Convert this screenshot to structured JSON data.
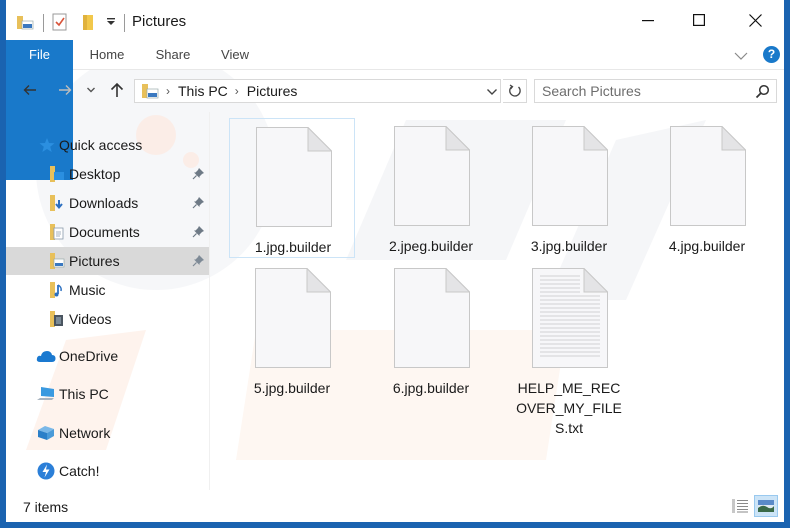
{
  "window": {
    "title": "Pictures",
    "controls": {
      "minimize": "minimize",
      "maximize": "maximize",
      "close": "close"
    }
  },
  "quick_access_toolbar": {
    "icons": [
      "properties-icon",
      "new-folder-icon",
      "customize-dropdown-icon"
    ]
  },
  "ribbon": {
    "tabs": [
      {
        "label": "File",
        "active": true
      },
      {
        "label": "Home"
      },
      {
        "label": "Share"
      },
      {
        "label": "View"
      }
    ],
    "help_label": "?"
  },
  "navigation": {
    "breadcrumb": [
      "This PC",
      "Pictures"
    ],
    "search_placeholder": "Search Pictures"
  },
  "sidebar": {
    "quick_access": {
      "label": "Quick access"
    },
    "pinned": [
      {
        "label": "Desktop",
        "pinned": true
      },
      {
        "label": "Downloads",
        "pinned": true
      },
      {
        "label": "Documents",
        "pinned": true
      },
      {
        "label": "Pictures",
        "pinned": true,
        "selected": true
      },
      {
        "label": "Music",
        "pinned": false
      },
      {
        "label": "Videos",
        "pinned": false
      }
    ],
    "locations": [
      {
        "label": "OneDrive"
      },
      {
        "label": "This PC"
      },
      {
        "label": "Network"
      },
      {
        "label": "Catch!"
      }
    ]
  },
  "files": [
    {
      "name": "1.jpg.builder",
      "type": "blank",
      "selected": true
    },
    {
      "name": "2.jpeg.builder",
      "type": "blank"
    },
    {
      "name": "3.jpg.builder",
      "type": "blank"
    },
    {
      "name": "4.jpg.builder",
      "type": "blank"
    },
    {
      "name": "5.jpg.builder",
      "type": "blank"
    },
    {
      "name": "6.jpg.builder",
      "type": "blank"
    },
    {
      "name": "HELP_ME_RECOVER_MY_FILES.txt",
      "type": "text"
    }
  ],
  "status": {
    "item_count": "7 items",
    "views": [
      "details-view",
      "large-icons-view"
    ],
    "active_view": "large-icons-view"
  },
  "colors": {
    "accent": "#1979ca",
    "frame": "#1a63b0",
    "selection": "#cce4f7",
    "sidebar_selected": "#d9d9d9"
  }
}
